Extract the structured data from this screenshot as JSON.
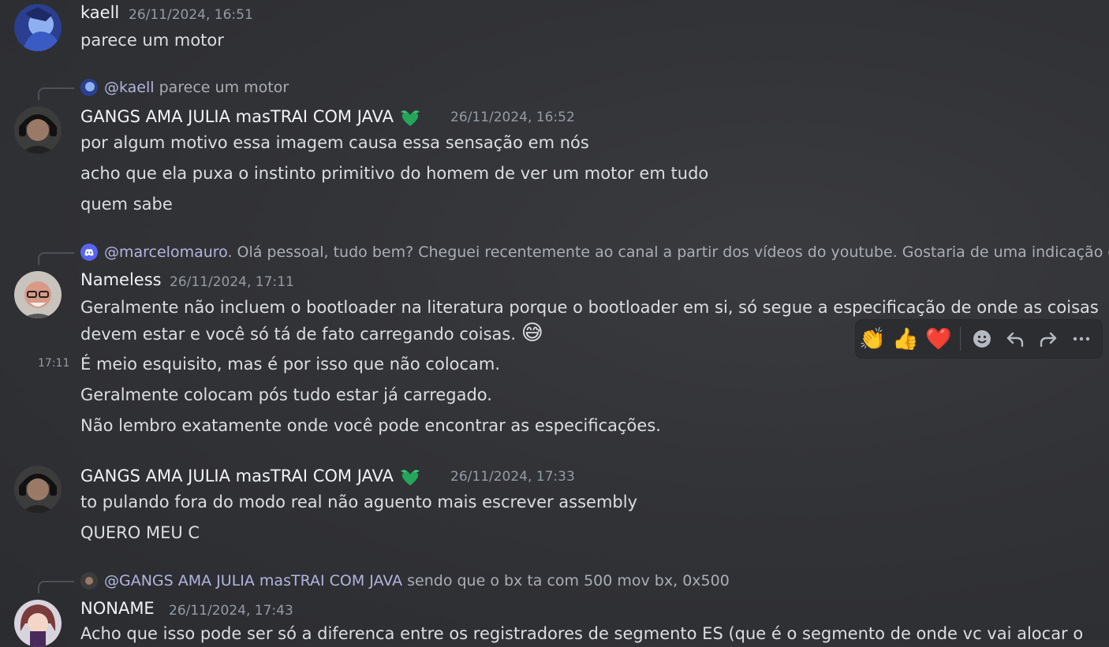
{
  "messages": [
    {
      "author": "kaell",
      "timestamp": "26/11/2024, 16:51",
      "lines": [
        "parece um motor"
      ]
    },
    {
      "reply_to": {
        "mention": "@kaell",
        "text": "parece um motor"
      },
      "author": "GANGS AMA JULIA masTRAI COM JAVA",
      "badge_icon": "leaf-heart-icon",
      "timestamp": "26/11/2024, 16:52",
      "lines": [
        "por algum motivo essa imagem causa essa sensação em nós",
        "acho que ela puxa o instinto primitivo do homem de ver um motor em tudo",
        "quem sabe"
      ]
    },
    {
      "reply_to": {
        "mention": "@marcelomauro.",
        "text": "Olá pessoal, tudo bem? Cheguei recentemente ao canal a partir dos vídeos do youtube. Gostaria de uma indicação d..."
      },
      "author": "Nameless",
      "timestamp": "26/11/2024, 17:11",
      "lines": [
        "Geralmente não incluem o bootloader na literatura porque o bootloader em si, só segue a especificação de onde as coisas",
        "devem estar e você só tá de fato carregando coisas.",
        "É meio esquisito, mas é por isso que não colocam.",
        "Geralmente colocam pós tudo estar já carregado.",
        "Não lembro exatamente onde você pode encontrar as especificações."
      ],
      "emoji": "😅",
      "hover_time": "17:11"
    },
    {
      "author": "GANGS AMA JULIA masTRAI COM JAVA",
      "badge_icon": "leaf-heart-icon",
      "timestamp": "26/11/2024, 17:33",
      "lines": [
        "to pulando fora do modo real não aguento mais escrever assembly",
        "QUERO MEU C"
      ]
    },
    {
      "reply_to": {
        "mention": "@GANGS AMA JULIA masTRAI COM JAVA",
        "text": "sendo que o bx ta com 500 mov bx, 0x500"
      },
      "author": "NONAME",
      "timestamp": "26/11/2024, 17:43",
      "lines": [
        "Acho que isso pode ser só a diferenca entre os registradores de segmento ES (que é o segmento de onde vc vai alocar o"
      ]
    }
  ],
  "toolbar": {
    "reactions": [
      "👏",
      "👍",
      "❤️"
    ],
    "actions": [
      "add-reaction-icon",
      "reply-icon",
      "forward-icon",
      "more-icon"
    ]
  },
  "colors": {
    "background": "#323337",
    "text": "#dbdee1",
    "muted": "#949ba4",
    "badge": "#23a55a"
  }
}
